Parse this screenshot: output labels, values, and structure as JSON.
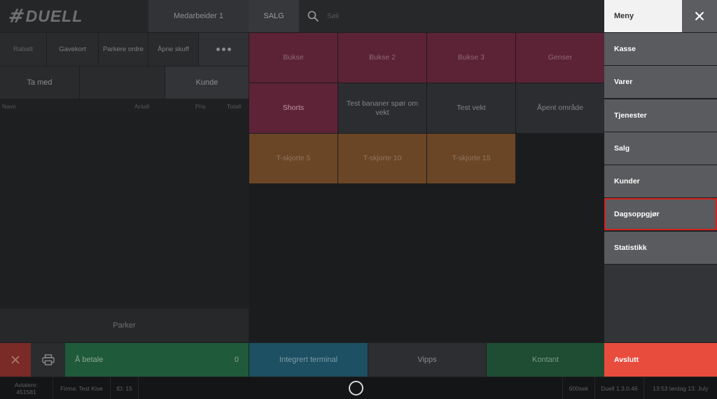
{
  "app": {
    "brand": "DUELL",
    "brand_mark": "#"
  },
  "header": {
    "employee": "Medarbeider 1",
    "mode_tab": "SALG",
    "search_placeholder": "Søk"
  },
  "actions": {
    "discount": "Rabatt",
    "giftcard": "Gavekort",
    "park_order": "Parkere ordre",
    "open_drawer": "Åpne skuff",
    "more_icon": "more-dots-icon"
  },
  "order": {
    "takeaway": "Ta med",
    "customer": "Kunde",
    "columns": {
      "name": "Navn",
      "qty": "Antall",
      "price": "Pris",
      "total": "Totalt"
    },
    "park": "Parker"
  },
  "payment": {
    "cancel_icon": "close-icon",
    "print_icon": "printer-icon",
    "pay_label": "Å betale",
    "pay_amount": "0",
    "terminal": "Integrert terminal",
    "vipps": "Vipps",
    "cash": "Kontant"
  },
  "products": [
    {
      "label": "Bukse",
      "color": "#5c2236"
    },
    {
      "label": "Bukse 2",
      "color": "#5c2236"
    },
    {
      "label": "Bukse 3",
      "color": "#5c2236"
    },
    {
      "label": "Genser",
      "color": "#5c2236"
    },
    {
      "label": "Shorts",
      "color": "#5f2338"
    },
    {
      "label": "Test bananer spør om vekt",
      "color": "#2c2d30"
    },
    {
      "label": "Test vekt",
      "color": "#2c2d30"
    },
    {
      "label": "Åpent område",
      "color": "#2c2d30"
    },
    {
      "label": "T-skjorte 5",
      "color": "#6b4626"
    },
    {
      "label": "T-skjorte 10",
      "color": "#6b4626"
    },
    {
      "label": "T-skjorte 15",
      "color": "#6b4626"
    }
  ],
  "menu": {
    "title": "Meny",
    "close_icon": "close-icon",
    "items": [
      "Kasse",
      "Varer",
      "Tjenester",
      "Salg",
      "Kunder",
      "Dagsoppgjør",
      "Statistikk"
    ],
    "highlighted": "Dagsoppgjør",
    "exit": "Avslutt",
    "accent": "#e84c3d"
  },
  "status": {
    "agreement": "Avtalenr: 451581",
    "company": "Firma: Test Kise",
    "id": "ID: 15",
    "sek": "600sek",
    "version": "Duell 1.3.0.46",
    "datetime": "13:53 lørdag 13. July"
  }
}
